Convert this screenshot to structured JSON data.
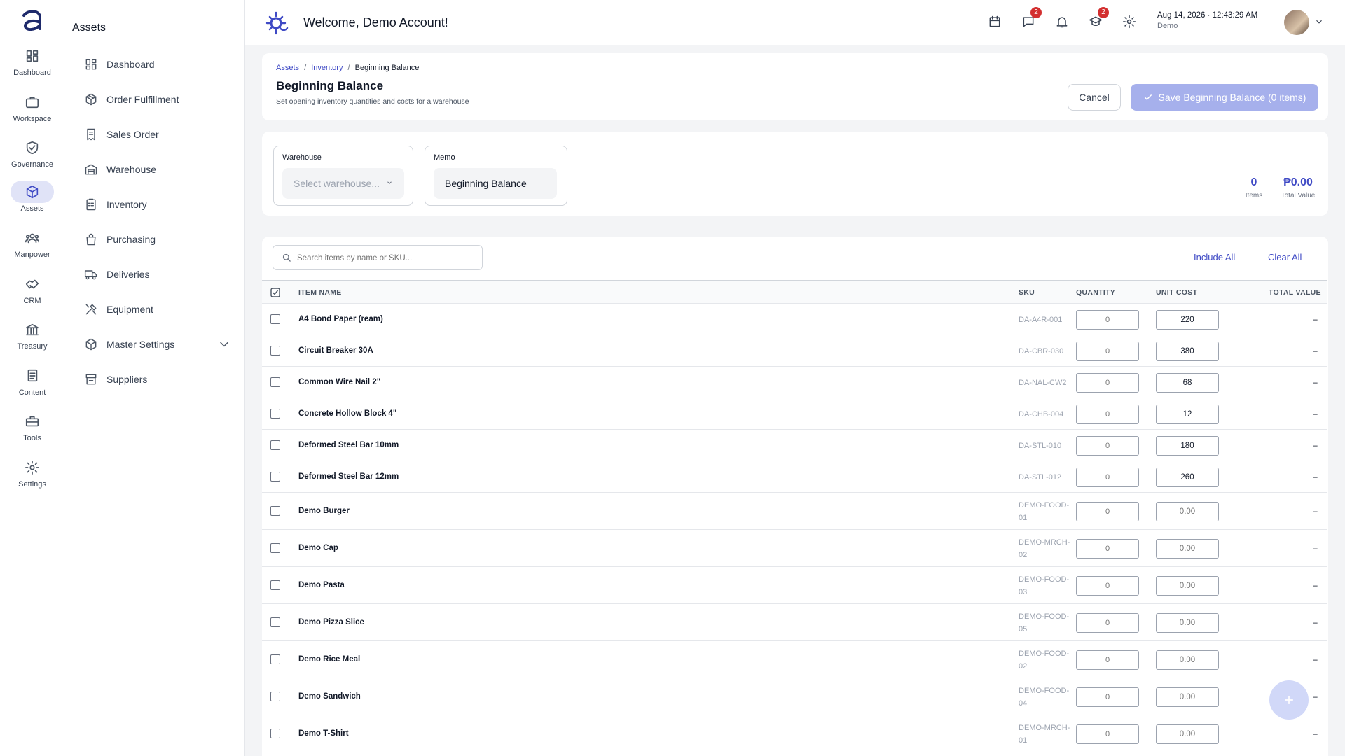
{
  "rail": {
    "items": [
      {
        "label": "Dashboard",
        "icon": "dashboard-icon"
      },
      {
        "label": "Workspace",
        "icon": "briefcase-icon"
      },
      {
        "label": "Governance",
        "icon": "shield-check-icon"
      },
      {
        "label": "Assets",
        "icon": "cube-icon"
      },
      {
        "label": "Manpower",
        "icon": "people-icon"
      },
      {
        "label": "CRM",
        "icon": "handshake-icon"
      },
      {
        "label": "Treasury",
        "icon": "bank-icon"
      },
      {
        "label": "Content",
        "icon": "document-icon"
      },
      {
        "label": "Tools",
        "icon": "toolbox-icon"
      },
      {
        "label": "Settings",
        "icon": "gear-icon"
      }
    ]
  },
  "sidebar": {
    "title": "Assets",
    "items": [
      {
        "label": "Dashboard",
        "icon": "dashboard-icon"
      },
      {
        "label": "Order Fulfillment",
        "icon": "package-icon"
      },
      {
        "label": "Sales Order",
        "icon": "receipt-icon"
      },
      {
        "label": "Warehouse",
        "icon": "warehouse-icon"
      },
      {
        "label": "Inventory",
        "icon": "clipboard-icon"
      },
      {
        "label": "Purchasing",
        "icon": "shopping-bag-icon"
      },
      {
        "label": "Deliveries",
        "icon": "truck-icon"
      },
      {
        "label": "Equipment",
        "icon": "tools-icon"
      },
      {
        "label": "Master Settings",
        "icon": "cube-icon"
      },
      {
        "label": "Suppliers",
        "icon": "store-icon"
      }
    ]
  },
  "header": {
    "welcome": "Welcome, Demo Account!",
    "messages_badge": "2",
    "courses_badge": "2",
    "date": "Aug 14, 2026",
    "time": "12:43:29 AM",
    "user": "Demo"
  },
  "page": {
    "breadcrumb": [
      "Assets",
      "Inventory",
      "Beginning Balance"
    ],
    "title": "Beginning Balance",
    "subtitle": "Set opening inventory quantities and costs for a warehouse",
    "cancel_label": "Cancel",
    "save_label": "Save Beginning Balance (0 items)"
  },
  "form": {
    "warehouse_label": "Warehouse",
    "warehouse_placeholder": "Select warehouse...",
    "memo_label": "Memo",
    "memo_value": "Beginning Balance",
    "items_count": "0",
    "items_label": "Items",
    "total_value": "₱0.00",
    "total_value_label": "Total Value"
  },
  "table": {
    "search_placeholder": "Search items by name or SKU...",
    "include_all": "Include All",
    "clear_all": "Clear All",
    "columns": [
      "ITEM NAME",
      "SKU",
      "QUANTITY",
      "UNIT COST",
      "TOTAL VALUE"
    ],
    "qty_placeholder": "0",
    "cost_placeholder": "0.00",
    "rows": [
      {
        "name": "A4 Bond Paper (ream)",
        "sku": "DA-A4R-001",
        "cost": "220",
        "total": "–"
      },
      {
        "name": "Circuit Breaker 30A",
        "sku": "DA-CBR-030",
        "cost": "380",
        "total": "–"
      },
      {
        "name": "Common Wire Nail 2\"",
        "sku": "DA-NAL-CW2",
        "cost": "68",
        "total": "–"
      },
      {
        "name": "Concrete Hollow Block 4\"",
        "sku": "DA-CHB-004",
        "cost": "12",
        "total": "–"
      },
      {
        "name": "Deformed Steel Bar 10mm",
        "sku": "DA-STL-010",
        "cost": "180",
        "total": "–"
      },
      {
        "name": "Deformed Steel Bar 12mm",
        "sku": "DA-STL-012",
        "cost": "260",
        "total": "–"
      },
      {
        "name": "Demo Burger",
        "sku": "DEMO-FOOD-01",
        "cost": "",
        "total": "–"
      },
      {
        "name": "Demo Cap",
        "sku": "DEMO-MRCH-02",
        "cost": "",
        "total": "–"
      },
      {
        "name": "Demo Pasta",
        "sku": "DEMO-FOOD-03",
        "cost": "",
        "total": "–"
      },
      {
        "name": "Demo Pizza Slice",
        "sku": "DEMO-FOOD-05",
        "cost": "",
        "total": "–"
      },
      {
        "name": "Demo Rice Meal",
        "sku": "DEMO-FOOD-02",
        "cost": "",
        "total": "–"
      },
      {
        "name": "Demo Sandwich",
        "sku": "DEMO-FOOD-04",
        "cost": "",
        "total": "–"
      },
      {
        "name": "Demo T-Shirt",
        "sku": "DEMO-MRCH-01",
        "cost": "",
        "total": "–"
      }
    ]
  },
  "colors": {
    "accent": "#3f4ac5",
    "save_disabled": "#a6b0ec",
    "badge": "#d32f2f"
  }
}
